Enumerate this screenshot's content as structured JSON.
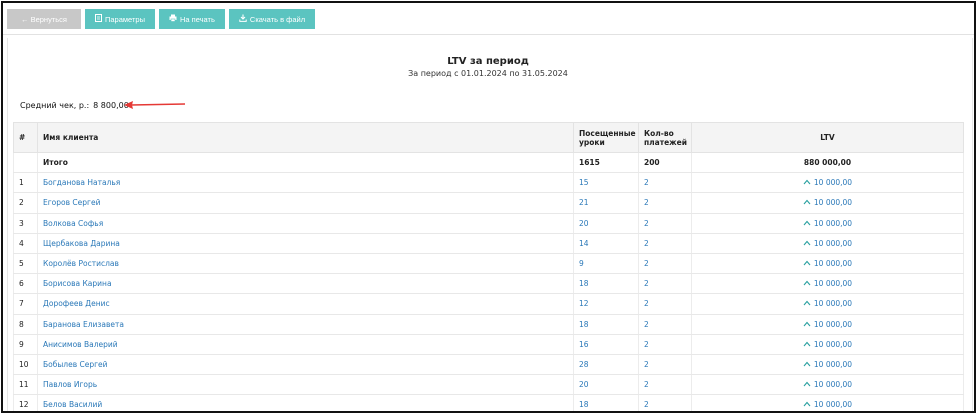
{
  "toolbar": {
    "back_label": "← Вернуться",
    "params_label": "Параметры",
    "print_label": "На печать",
    "download_label": "Скачать в файл"
  },
  "report": {
    "title": "LTV за период",
    "period": "За период с 01.01.2024 по 31.05.2024",
    "avg_check_label": "Средний чек, р.:",
    "avg_check_value": "8 800,00"
  },
  "table": {
    "headers": {
      "num": "#",
      "client": "Имя клиента",
      "lessons": "Посещенные уроки",
      "payments": "Кол-во платежей",
      "ltv": "LTV"
    },
    "total": {
      "label": "Итого",
      "lessons": "1615",
      "payments": "200",
      "ltv": "880 000,00"
    },
    "rows": [
      {
        "num": "1",
        "name": "Богданова Наталья",
        "lessons": "15",
        "payments": "2",
        "ltv": "10 000,00"
      },
      {
        "num": "2",
        "name": "Егоров Сергей",
        "lessons": "21",
        "payments": "2",
        "ltv": "10 000,00"
      },
      {
        "num": "3",
        "name": "Волкова Софья",
        "lessons": "20",
        "payments": "2",
        "ltv": "10 000,00"
      },
      {
        "num": "4",
        "name": "Щербакова Дарина",
        "lessons": "14",
        "payments": "2",
        "ltv": "10 000,00"
      },
      {
        "num": "5",
        "name": "Королёв Ростислав",
        "lessons": "9",
        "payments": "2",
        "ltv": "10 000,00"
      },
      {
        "num": "6",
        "name": "Борисова Карина",
        "lessons": "18",
        "payments": "2",
        "ltv": "10 000,00"
      },
      {
        "num": "7",
        "name": "Дорофеев Денис",
        "lessons": "12",
        "payments": "2",
        "ltv": "10 000,00"
      },
      {
        "num": "8",
        "name": "Баранова Елизавета",
        "lessons": "18",
        "payments": "2",
        "ltv": "10 000,00"
      },
      {
        "num": "9",
        "name": "Анисимов Валерий",
        "lessons": "16",
        "payments": "2",
        "ltv": "10 000,00"
      },
      {
        "num": "10",
        "name": "Бобылев Сергей",
        "lessons": "28",
        "payments": "2",
        "ltv": "10 000,00"
      },
      {
        "num": "11",
        "name": "Павлов Игорь",
        "lessons": "20",
        "payments": "2",
        "ltv": "10 000,00"
      },
      {
        "num": "12",
        "name": "Белов Василий",
        "lessons": "18",
        "payments": "2",
        "ltv": "10 000,00"
      }
    ]
  },
  "icons": {
    "params": "document-icon",
    "print": "printer-icon",
    "download": "download-icon",
    "ltv_trend": "chevron-up-icon"
  },
  "colors": {
    "accent": "#5bc4c0",
    "link": "#2a78b8",
    "annotation_arrow": "#e53935"
  }
}
